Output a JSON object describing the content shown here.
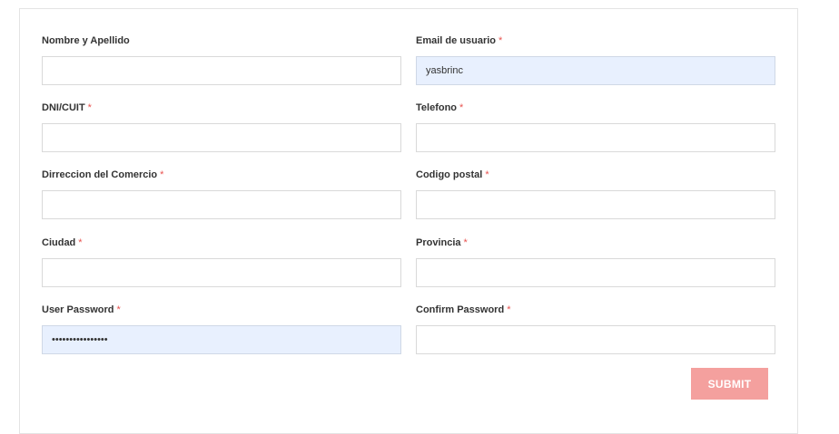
{
  "form": {
    "fields": [
      {
        "label": "Nombre y Apellido",
        "required": "",
        "value": ""
      },
      {
        "label": "Email de usuario",
        "required": "*",
        "value": "yasbrinc"
      },
      {
        "label": "DNI/CUIT",
        "required": "*",
        "value": ""
      },
      {
        "label": "Telefono",
        "required": "*",
        "value": ""
      },
      {
        "label": "Dirreccion del Comercio",
        "required": "*",
        "value": ""
      },
      {
        "label": "Codigo postal",
        "required": "*",
        "value": ""
      },
      {
        "label": "Ciudad",
        "required": "*",
        "value": ""
      },
      {
        "label": "Provincia",
        "required": "*",
        "value": ""
      },
      {
        "label": "User Password",
        "required": "*",
        "value": "••••••••••••••••"
      },
      {
        "label": "Confirm Password",
        "required": "*",
        "value": ""
      }
    ],
    "submit_label": "SUBMIT"
  },
  "colors": {
    "required_marker": "#e8524f",
    "submit_background": "#f4a09e",
    "autofill_background": "#e8f0fe"
  }
}
